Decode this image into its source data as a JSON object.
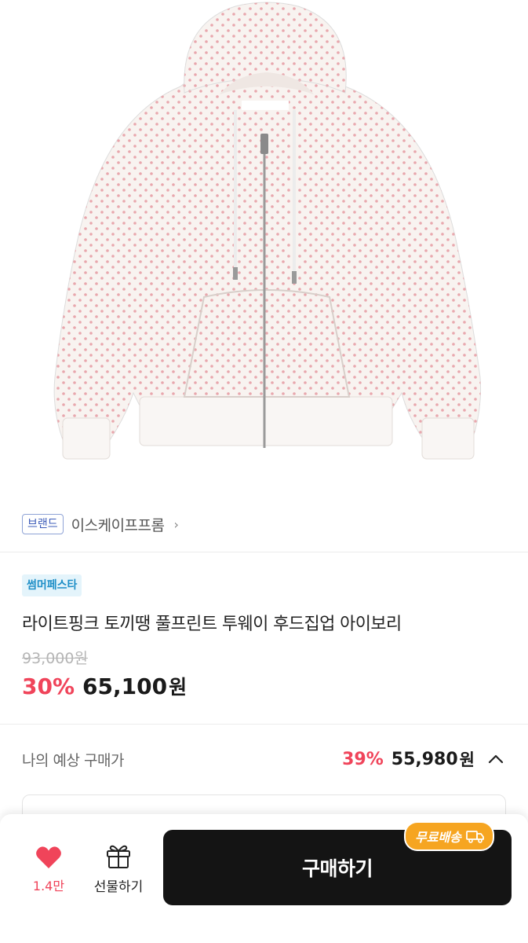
{
  "brand": {
    "tag": "브랜드",
    "name": "이스케이프프롬",
    "chevron": "›"
  },
  "promo": {
    "badge": "썸머페스타"
  },
  "product": {
    "title": "라이트핑크 토끼땡 풀프린트 투웨이 후드집업 아이보리",
    "original_price": "93,000원",
    "discount_rate": "30%",
    "sale_price": "65,100",
    "currency": "원"
  },
  "expected": {
    "label": "나의 예상 구매가",
    "rate": "39%",
    "price": "55,980",
    "currency": "원"
  },
  "bottom_bar": {
    "like_count": "1.4만",
    "gift_label": "선물하기",
    "buy_label": "구매하기",
    "shipping_badge": "무료배송"
  },
  "colors": {
    "accent_red": "#f0445a",
    "buy_button": "#141414",
    "shipping_badge": "#f6a521",
    "promo_text": "#1f8fc7",
    "brand_tag": "#3d5cb8"
  },
  "icons": [
    "heart-icon",
    "gift-icon",
    "chevron-up-icon",
    "chevron-right-icon",
    "truck-icon"
  ]
}
